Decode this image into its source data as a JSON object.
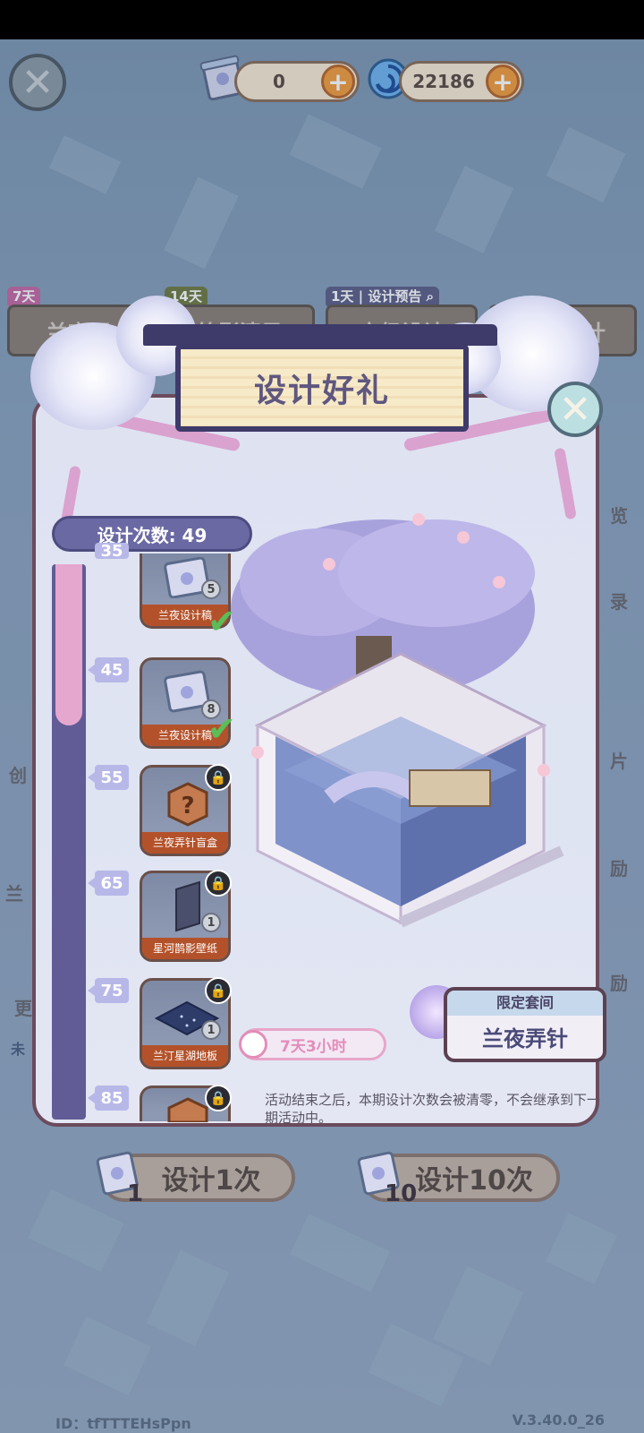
{
  "topbar": {
    "tickets": "0",
    "currency": "22186"
  },
  "tabs": [
    {
      "tag": "7天",
      "label": "兰夜弄",
      "tag_color": "#c46aa4"
    },
    {
      "tag": "14天",
      "label": "竹影清风",
      "tag_color": "#6f7a43"
    },
    {
      "tag": "1天",
      "label": "高级设计",
      "tag_color": "#5d5f88",
      "extra": "设计预告"
    },
    {
      "tag": "",
      "label": "限定设计",
      "tag_color": "#8a7f76"
    }
  ],
  "side_right": [
    "览",
    "录",
    "片",
    "励",
    "励"
  ],
  "side_left": [
    "创",
    "兰",
    "更",
    "未"
  ],
  "panel": {
    "title": "设计好礼",
    "count_label": "设计次数: 49"
  },
  "rewards": [
    {
      "level": "35",
      "name": "兰夜设计稿",
      "qty": "5",
      "done": true,
      "locked": false
    },
    {
      "level": "45",
      "name": "兰夜设计稿",
      "qty": "8",
      "done": true,
      "locked": false
    },
    {
      "level": "55",
      "name": "兰夜弄针盲盒",
      "qty": "",
      "done": false,
      "locked": true
    },
    {
      "level": "65",
      "name": "星河鹊影壁纸",
      "qty": "1",
      "done": false,
      "locked": true
    },
    {
      "level": "75",
      "name": "兰汀星湖地板",
      "qty": "1",
      "done": false,
      "locked": true
    },
    {
      "level": "85",
      "name": "",
      "qty": "",
      "done": false,
      "locked": true
    }
  ],
  "timer": "7天3小时",
  "suite": {
    "header": "限定套间",
    "name": "兰夜弄针"
  },
  "note": "活动结束之后，本期设计次数会被清零，不会继承到下一期活动中。",
  "buttons": {
    "design1": "设计1次",
    "design1_cost": "1",
    "design10": "设计10次",
    "design10_cost": "10"
  },
  "footer": {
    "id": "ID：tfTTTEHsPpn",
    "version": "V.3.40.0_26"
  },
  "colors": {
    "accent_orange": "#f29b3c",
    "panel_border": "#6b4b5c",
    "track": "#615c96",
    "track_fill": "#e6a7cf",
    "check": "#5bbd58"
  }
}
